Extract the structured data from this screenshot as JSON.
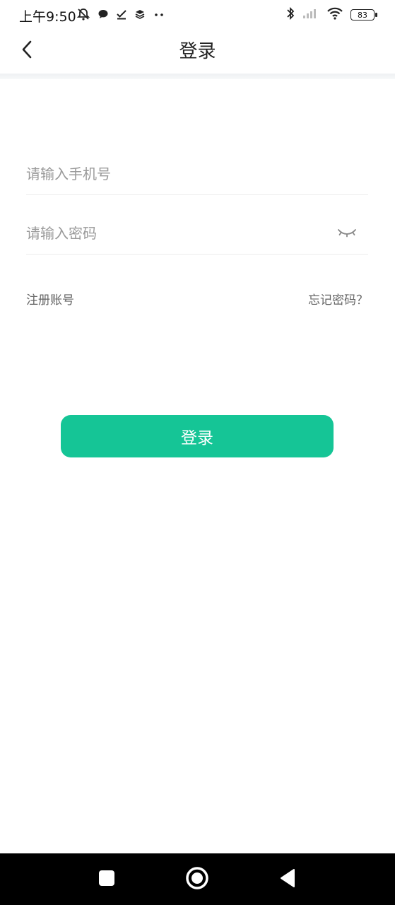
{
  "status_bar": {
    "time": "上午9:50",
    "battery": "83",
    "left_icons": [
      "bell-off-icon",
      "chat-bubble-icon",
      "check-icon",
      "layers-icon",
      "more-dots-icon"
    ],
    "right_icons": [
      "bluetooth-icon",
      "signal-icon",
      "wifi-icon",
      "battery-icon"
    ]
  },
  "header": {
    "title": "登录",
    "back_icon": "chevron-left-icon"
  },
  "form": {
    "phone_placeholder": "请输入手机号",
    "phone_value": "",
    "password_placeholder": "请输入密码",
    "password_value": "",
    "eye_icon": "eye-closed-icon"
  },
  "links": {
    "register": "注册账号",
    "forgot": "忘记密码？"
  },
  "login_button": {
    "label": "登录",
    "color": "#15c596"
  },
  "nav_bar": {
    "icons": [
      "square-recent-icon",
      "circle-home-icon",
      "triangle-back-icon"
    ]
  }
}
